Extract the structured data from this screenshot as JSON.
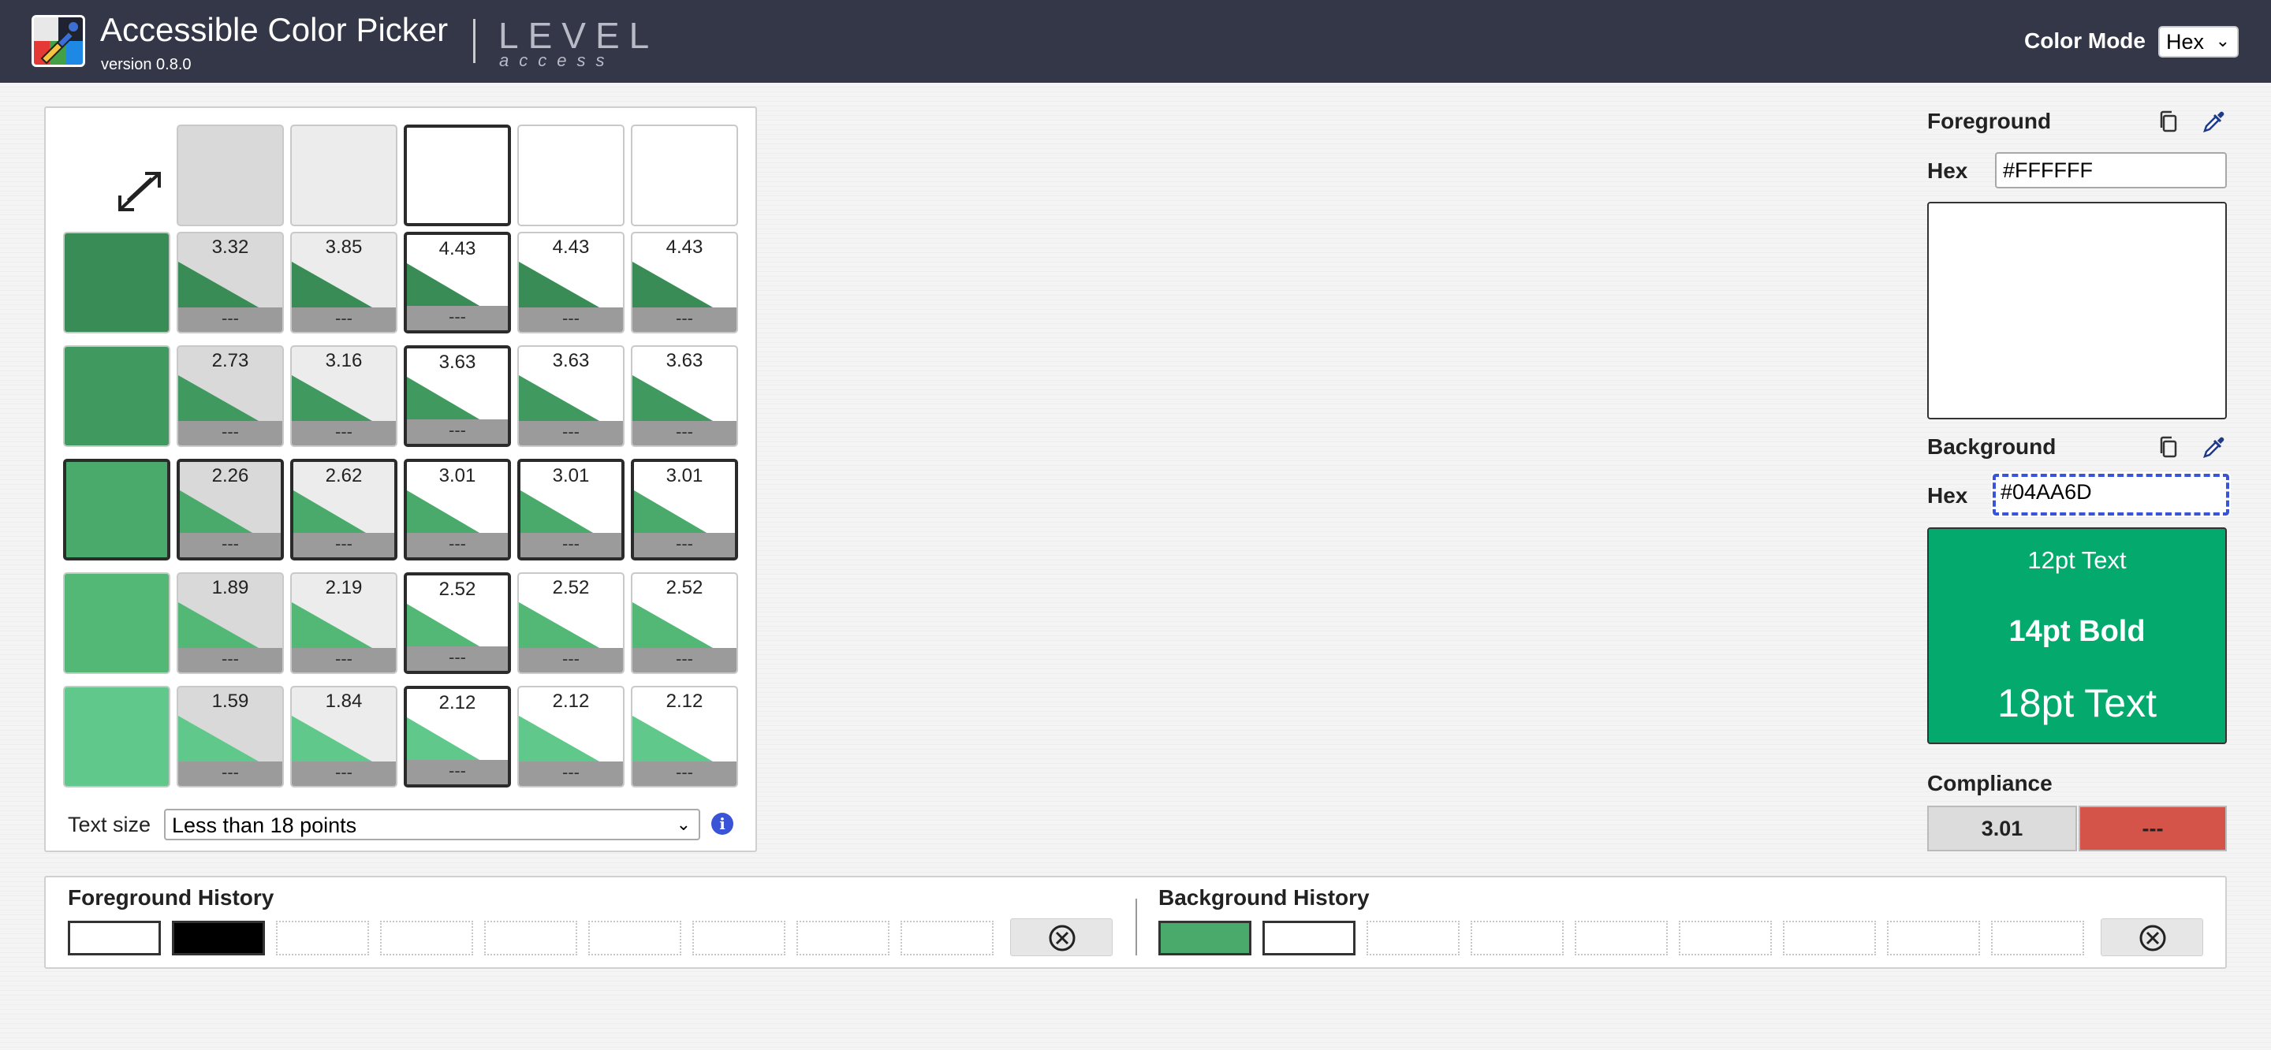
{
  "header": {
    "app_title": "Accessible Color Picker",
    "version": "version 0.8.0",
    "brand_top": "LEVEL",
    "brand_bottom": "access",
    "color_mode_label": "Color Mode",
    "color_mode_value": "Hex"
  },
  "grid": {
    "column_swatches": [
      "#d9d9d9",
      "#ececec",
      "#ffffff",
      "#ffffff",
      "#ffffff"
    ],
    "selected_column": 2,
    "selected_row": 2,
    "rows": [
      {
        "color": "#3a8c56",
        "ratios": [
          "3.32",
          "3.85",
          "4.43",
          "4.43",
          "4.43"
        ]
      },
      {
        "color": "#40995e",
        "ratios": [
          "2.73",
          "3.16",
          "3.63",
          "3.63",
          "3.63"
        ]
      },
      {
        "color": "#4aaa6c",
        "ratios": [
          "2.26",
          "2.62",
          "3.01",
          "3.01",
          "3.01"
        ]
      },
      {
        "color": "#53b776",
        "ratios": [
          "1.89",
          "2.19",
          "2.52",
          "2.52",
          "2.52"
        ]
      },
      {
        "color": "#5fc88a",
        "ratios": [
          "1.59",
          "1.84",
          "2.12",
          "2.12",
          "2.12"
        ]
      }
    ],
    "status_placeholder": "---",
    "text_size_label": "Text size",
    "text_size_value": "Less than 18 points"
  },
  "foreground": {
    "label": "Foreground",
    "hex_label": "Hex",
    "hex_value": "#FFFFFF",
    "color": "#ffffff"
  },
  "background": {
    "label": "Background",
    "hex_label": "Hex",
    "hex_value": "#04AA6D",
    "color": "#04aa6d",
    "preview_12": "12pt Text",
    "preview_14": "14pt Bold",
    "preview_18": "18pt Text"
  },
  "compliance": {
    "label": "Compliance",
    "ratio": "3.01",
    "status": "---",
    "status_color": "#d4544a"
  },
  "history": {
    "fg_label": "Foreground History",
    "bg_label": "Background History",
    "fg_colors": [
      "#ffffff",
      "#000000"
    ],
    "bg_colors": [
      "#4aaa6c",
      "#ffffff"
    ],
    "slot_count": 9
  }
}
